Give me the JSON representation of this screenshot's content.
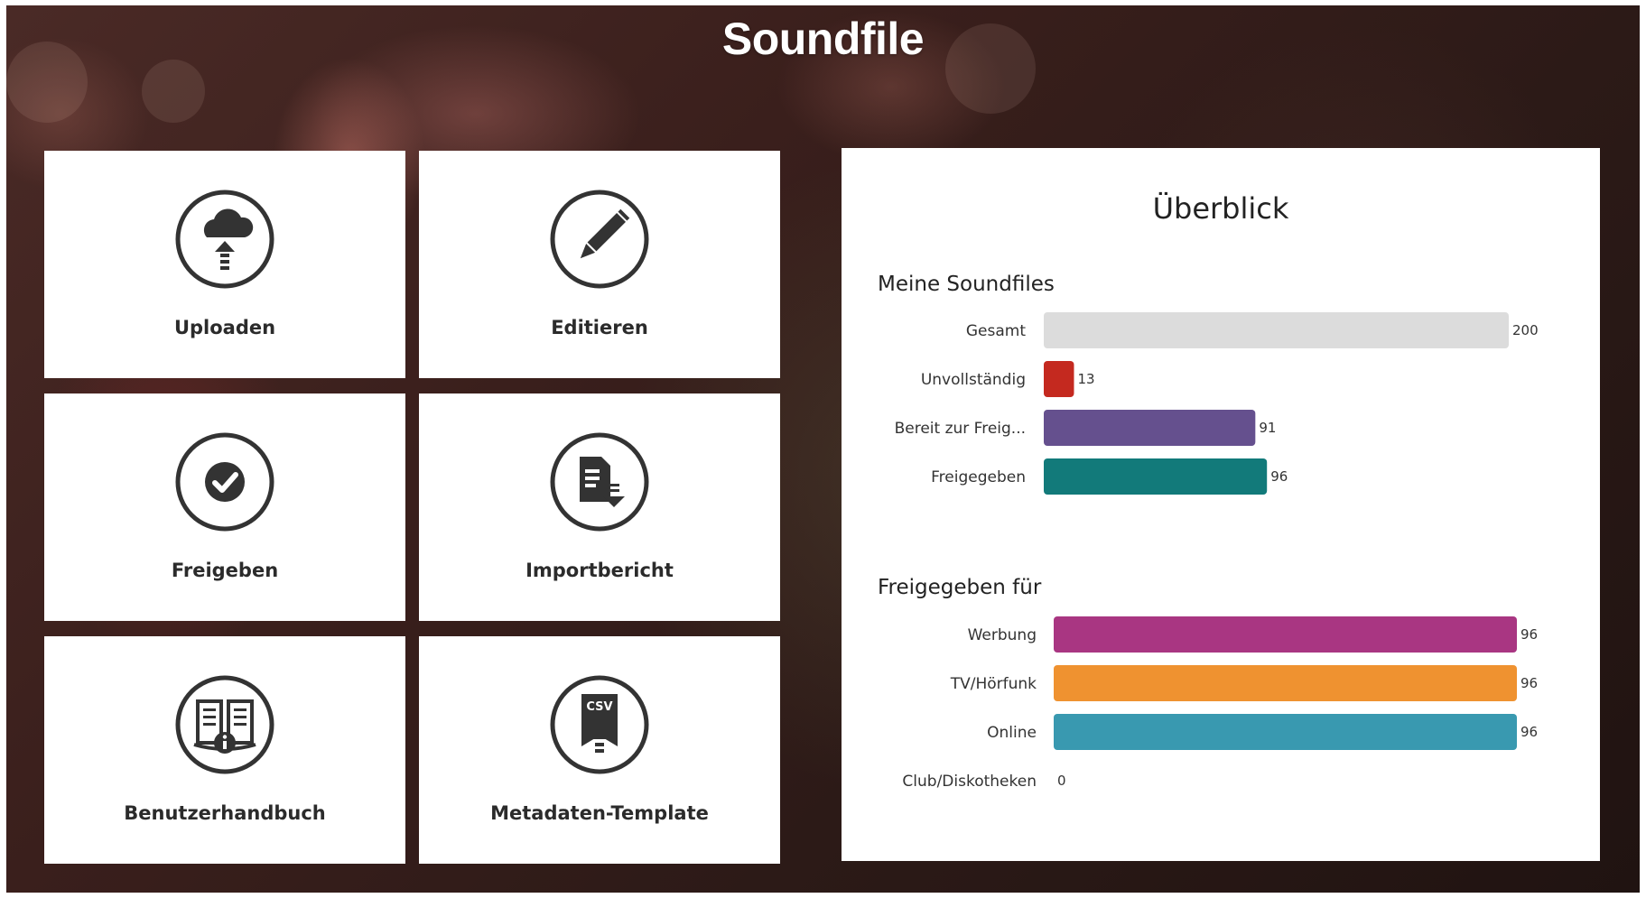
{
  "header": {
    "title": "Soundfile"
  },
  "tiles": [
    {
      "label": "Uploaden",
      "icon": "cloud-upload-icon"
    },
    {
      "label": "Editieren",
      "icon": "pencil-icon"
    },
    {
      "label": "Freigeben",
      "icon": "check-circle-icon"
    },
    {
      "label": "Importbericht",
      "icon": "document-import-icon"
    },
    {
      "label": "Benutzerhandbuch",
      "icon": "manual-info-icon"
    },
    {
      "label": "Metadaten-Template",
      "icon": "csv-file-upload-icon",
      "badge": "CSV"
    }
  ],
  "overview": {
    "title": "Überblick",
    "sections": [
      {
        "title": "Meine Soundfiles"
      },
      {
        "title": "Freigegeben für"
      }
    ]
  },
  "chart_data": [
    {
      "type": "bar",
      "orientation": "horizontal",
      "title": "Meine Soundfiles",
      "categories": [
        "Gesamt",
        "Unvollständig",
        "Bereit zur Freig...",
        "Freigegeben"
      ],
      "values": [
        200,
        13,
        91,
        96
      ],
      "colors": [
        "#dcdcdc",
        "#c4291f",
        "#65508e",
        "#127a7a"
      ],
      "xlim": [
        0,
        200
      ],
      "grid": false
    },
    {
      "type": "bar",
      "orientation": "horizontal",
      "title": "Freigegeben für",
      "categories": [
        "Werbung",
        "TV/Hörfunk",
        "Online",
        "Club/Diskotheken"
      ],
      "values": [
        96,
        96,
        96,
        0
      ],
      "colors": [
        "#a93682",
        "#ef9230",
        "#3999b0",
        "#999999"
      ],
      "xlim": [
        0,
        96
      ],
      "grid": false
    }
  ]
}
